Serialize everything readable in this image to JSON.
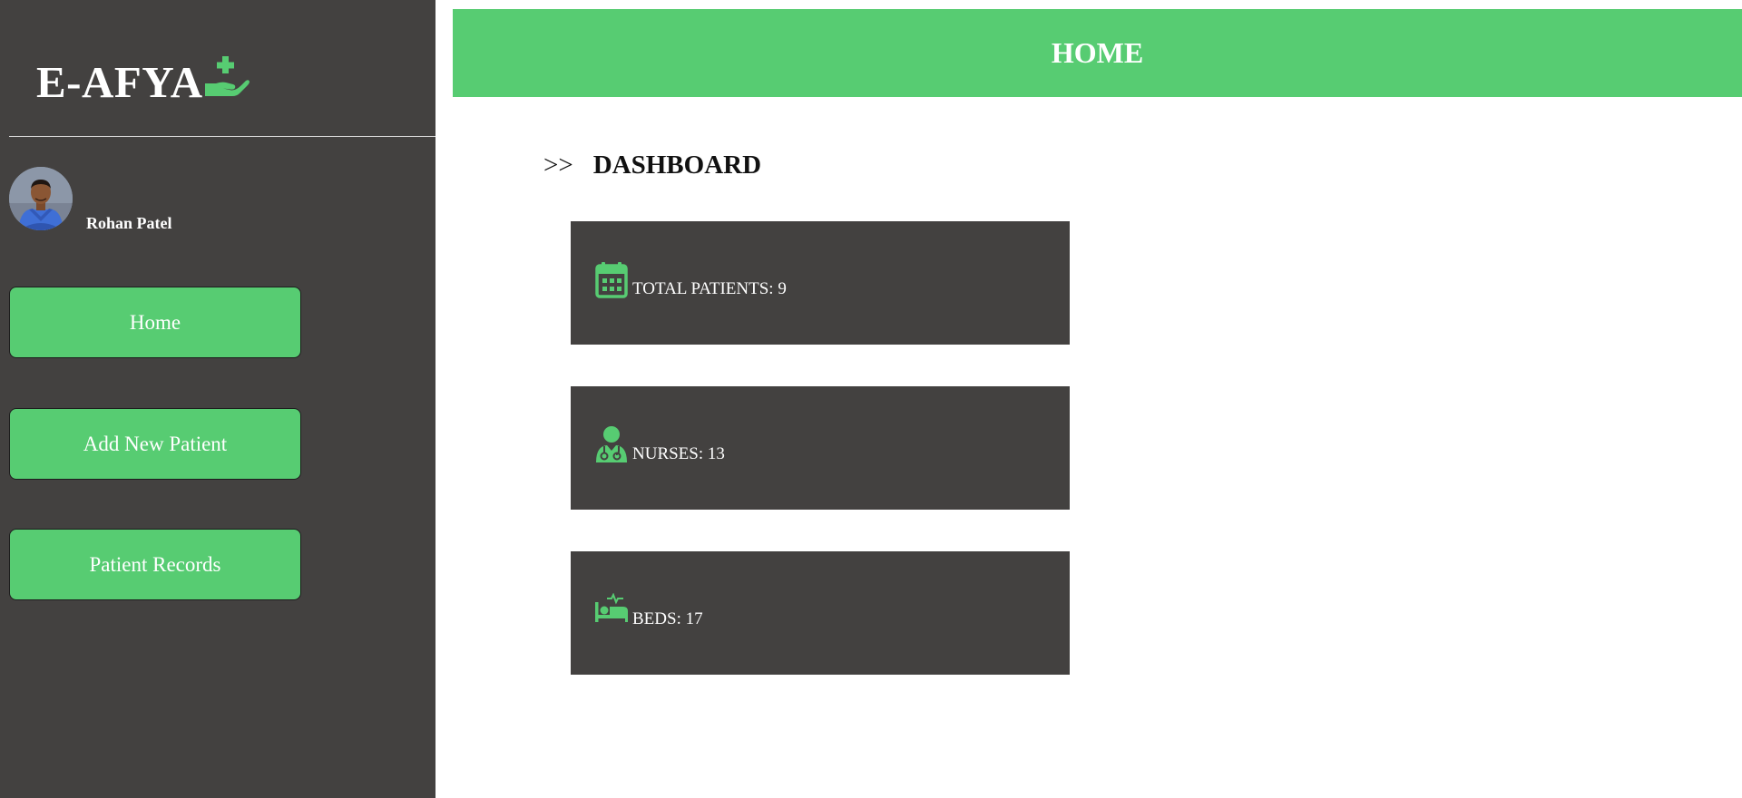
{
  "app": {
    "brand": "E-AFYA",
    "brand_icon": "hand-holding-medical-icon"
  },
  "colors": {
    "accent": "#57cc72",
    "sidebar_bg": "#434140",
    "card_bg": "#434140"
  },
  "user": {
    "name": "Rohan Patel",
    "avatar": "doctor-avatar"
  },
  "nav": [
    {
      "label": "Home"
    },
    {
      "label": "Add New Patient"
    },
    {
      "label": "Patient Records"
    }
  ],
  "header": {
    "title": "HOME"
  },
  "dashboard": {
    "arrows": ">>",
    "title": "DASHBOARD",
    "cards": [
      {
        "icon": "calendar-icon",
        "text": "TOTAL PATIENTS: 9"
      },
      {
        "icon": "nurse-icon",
        "text": "NURSES: 13"
      },
      {
        "icon": "bed-pulse-icon",
        "text": "BEDS: 17"
      }
    ]
  }
}
